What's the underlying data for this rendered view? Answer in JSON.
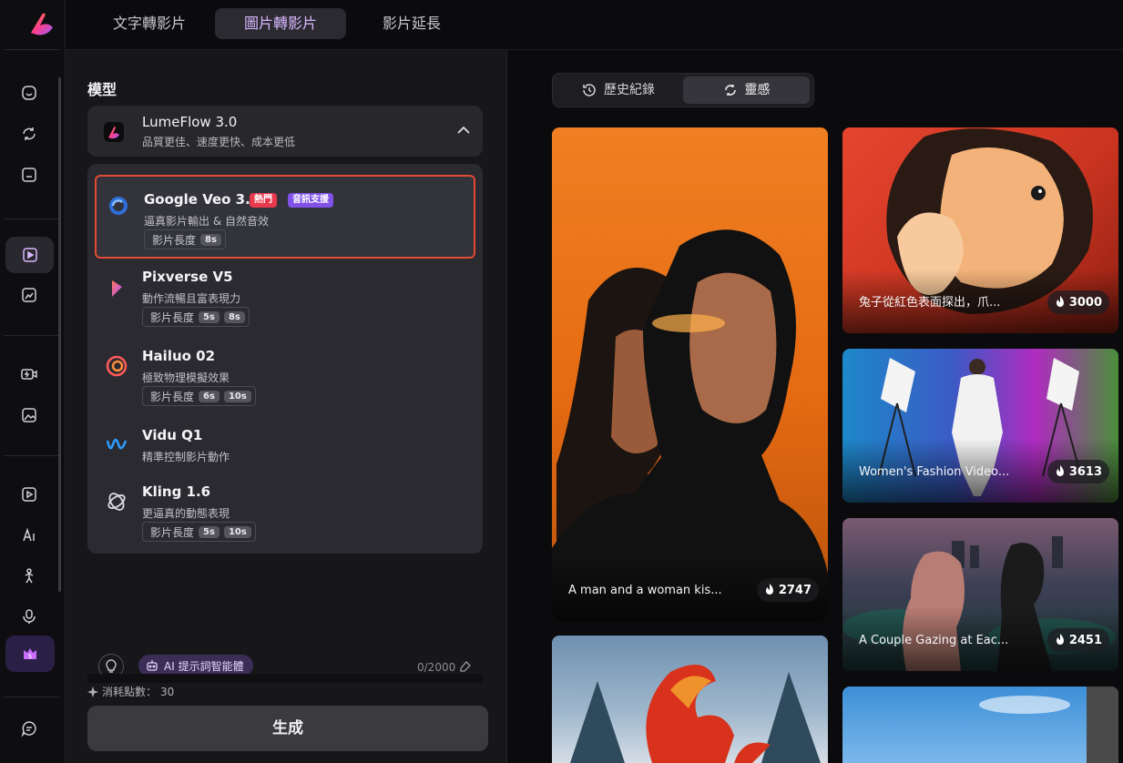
{
  "topbar": {
    "tabs": [
      {
        "label": "文字轉影片",
        "active": false
      },
      {
        "label": "圖片轉影片",
        "active": true
      },
      {
        "label": "影片延長",
        "active": false
      }
    ]
  },
  "sidebar": {
    "items": [
      {
        "icon": "home-icon",
        "active": false
      },
      {
        "icon": "refresh-icon",
        "active": false
      },
      {
        "icon": "folder-icon",
        "active": false
      },
      {
        "icon": "ai-video-icon",
        "active": true
      },
      {
        "icon": "image-edit-icon",
        "active": false
      },
      {
        "icon": "video-flash-icon",
        "active": false
      },
      {
        "icon": "image-magic-icon",
        "active": false
      },
      {
        "icon": "play-edit-icon",
        "active": false
      },
      {
        "icon": "ai-text-icon",
        "active": false
      },
      {
        "icon": "dance-icon",
        "active": false
      },
      {
        "icon": "voice-icon",
        "active": false
      },
      {
        "icon": "upgrade-crown-icon",
        "active": false
      },
      {
        "icon": "chat-icon",
        "active": false
      }
    ]
  },
  "panel": {
    "title": "模型",
    "selected_model": {
      "name": "LumeFlow 3.0",
      "desc": "品質更佳、速度更快、成本更低"
    },
    "duration_label": "影片長度",
    "models": [
      {
        "name": "Google Veo 3.1",
        "desc": "逼真影片輸出 & 自然音效",
        "badges": [
          "熱門",
          "音訊支援"
        ],
        "durations": [
          "8s"
        ],
        "selected": true,
        "icon": "google-veo-icon"
      },
      {
        "name": "Pixverse V5",
        "desc": "動作流暢且富表現力",
        "badges": [],
        "durations": [
          "5s",
          "8s"
        ],
        "selected": false,
        "icon": "pixverse-icon"
      },
      {
        "name": "Hailuo 02",
        "desc": "極致物理模擬效果",
        "badges": [],
        "durations": [
          "6s",
          "10s"
        ],
        "selected": false,
        "icon": "hailuo-icon"
      },
      {
        "name": "Vidu Q1",
        "desc": "精準控制影片動作",
        "badges": [],
        "durations": [],
        "selected": false,
        "icon": "vidu-icon"
      },
      {
        "name": "Kling 1.6",
        "desc": "更逼真的動態表現",
        "badges": [],
        "durations": [
          "5s",
          "10s"
        ],
        "selected": false,
        "icon": "kling-icon"
      }
    ],
    "ai_prompt_label": "AI 提示詞智能體",
    "counter": "0/2000",
    "cost_label": "消耗點數：",
    "cost_value": "30",
    "generate_label": "生成"
  },
  "gallery": {
    "tabs": [
      {
        "label": "歷史紀錄",
        "icon": "history-icon",
        "active": false
      },
      {
        "label": "靈感",
        "icon": "inspiration-icon",
        "active": true
      }
    ],
    "cards": [
      {
        "caption": "A man and a woman kis...",
        "likes": "2747"
      },
      {
        "caption": "兔子從紅色表面探出，爪...",
        "likes": "3000"
      },
      {
        "caption": "Women's Fashion Video...",
        "likes": "3613"
      },
      {
        "caption": "A Couple Gazing at Eac...",
        "likes": "2451"
      },
      {
        "caption": "",
        "likes": ""
      },
      {
        "caption": "",
        "likes": ""
      }
    ]
  },
  "colors": {
    "accent": "#d9b8ff",
    "selection_border": "#e24a33",
    "hot_badge": "#e8394d",
    "audio_badge": "#8152e8"
  }
}
